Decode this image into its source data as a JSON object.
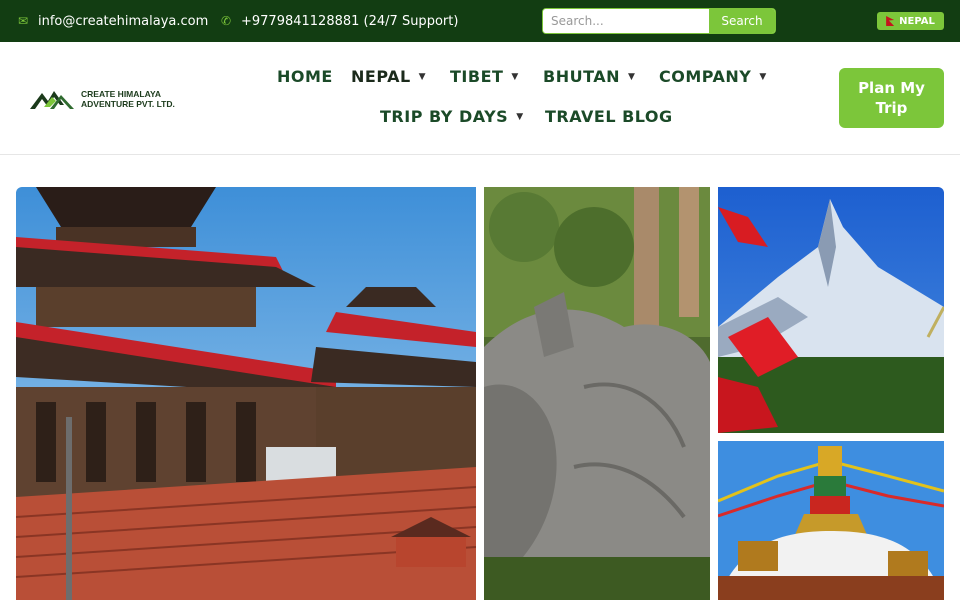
{
  "topbar": {
    "email": "info@createhimalaya.com",
    "phone": "+9779841128881 (24/7 Support)",
    "search_placeholder": "Search...",
    "search_label": "Search",
    "language_label": "NEPAL"
  },
  "brand": {
    "line1": "CREATE HIMALAYA",
    "line2": "ADVENTURE PVT. LTD."
  },
  "nav": {
    "home": "HOME",
    "nepal": "NEPAL",
    "tibet": "TIBET",
    "bhutan": "BHUTAN",
    "company": "COMPANY",
    "trip_by_days": "TRIP BY DAYS",
    "travel_blog": "TRAVEL BLOG"
  },
  "cta": {
    "line1": "Plan My",
    "line2": "Trip"
  },
  "colors": {
    "topbar_bg": "#123d12",
    "accent": "#7cc63a",
    "nav_text": "#1b4a28"
  },
  "icons": {
    "email": "envelope-icon",
    "phone": "phone-icon",
    "flag": "nepal-flag-icon",
    "dropdown": "caret-down-icon"
  }
}
